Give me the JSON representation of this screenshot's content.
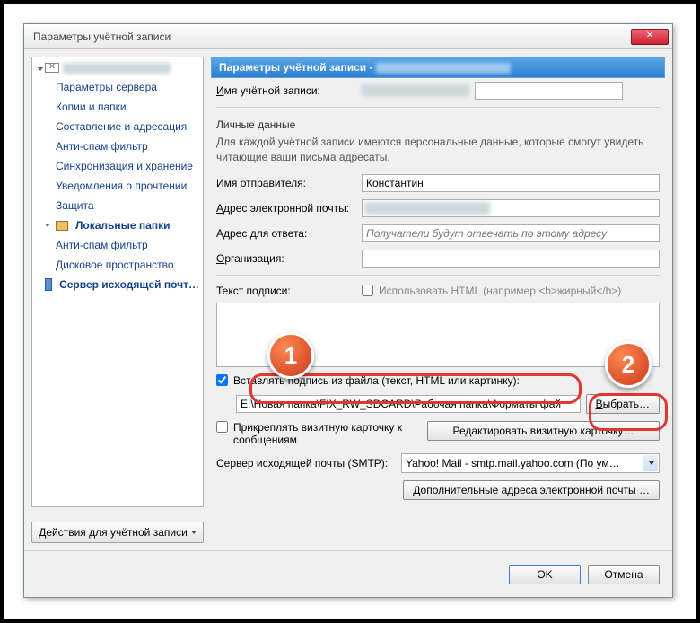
{
  "window": {
    "title": "Параметры учётной записи"
  },
  "tree": {
    "account_items": [
      "Параметры сервера",
      "Копии и папки",
      "Составление и адресация",
      "Анти-спам фильтр",
      "Синхронизация и хранение",
      "Уведомления о прочтении",
      "Защита"
    ],
    "local_label": "Локальные папки",
    "local_items": [
      "Анти-спам фильтр",
      "Дисковое пространство"
    ],
    "smtp_label": "Сервер исходящей почт…"
  },
  "actions_btn": "Действия для учётной записи",
  "header": "Параметры учётной записи - ",
  "account_name_label": "Имя учётной записи:",
  "personal": {
    "title": "Личные данные",
    "desc": "Для каждой учётной записи имеются персональные данные, которые смогут увидеть читающие ваши письма адресаты.",
    "sender_label": "Имя отправителя:",
    "sender_value": "Константин",
    "email_label": "Адрес электронной почты:",
    "reply_label": "Адрес для ответа:",
    "reply_placeholder": "Получатели будут отвечать по этому адресу",
    "org_label": "Организация:"
  },
  "signature": {
    "label": "Текст подписи:",
    "html_cb": "Использовать HTML (например <b>жирный</b>)",
    "file_cb": "Вставлять подпись из файла (текст, HTML или картинку):",
    "file_path": "E:\\Новая папка\\FIX_RW_SDCARD\\Рабочая папка\\Форматы фай",
    "browse": "Выбрать…"
  },
  "vcard": {
    "cb": "Прикреплять визитную карточку к сообщениям",
    "edit": "Редактировать визитную карточку…"
  },
  "smtp": {
    "label": "Сервер исходящей почты (SMTP):",
    "value": "Yahoo! Mail - smtp.mail.yahoo.com (По ум…"
  },
  "extra_btn": "Дополнительные адреса электронной почты …",
  "footer": {
    "ok": "OK",
    "cancel": "Отмена"
  },
  "badges": {
    "one": "1",
    "two": "2"
  }
}
